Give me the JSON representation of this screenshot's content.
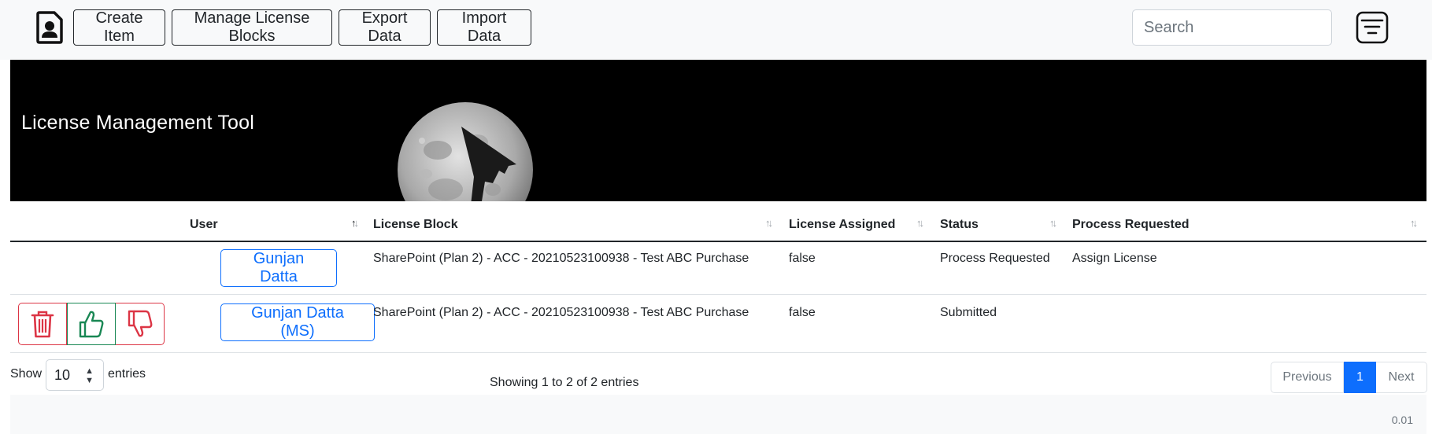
{
  "nav": {
    "logo_icon": "user-document-icon",
    "buttons": [
      "Create Item",
      "Manage License Blocks",
      "Export Data",
      "Import Data"
    ],
    "search_placeholder": "Search",
    "filter_icon": "filter-lines-icon"
  },
  "banner": {
    "title": "License Management Tool",
    "image": "moon-with-stealth-bomber"
  },
  "table": {
    "columns": [
      "User",
      "License Block",
      "License Assigned",
      "Status",
      "Process Requested"
    ],
    "sort": {
      "column": "User",
      "direction": "ascending"
    },
    "rows": [
      {
        "user": "Gunjan Datta",
        "license_block": "SharePoint (Plan 2) - ACC - 20210523100938 - Test ABC Purchase",
        "license_assigned": "false",
        "status": "Process Requested",
        "process_requested": "Assign License",
        "actions": []
      },
      {
        "user": "Gunjan Datta (MS)",
        "license_block": "SharePoint (Plan 2) - ACC - 20210523100938 - Test ABC Purchase",
        "license_assigned": "false",
        "status": "Submitted",
        "process_requested": "",
        "actions": [
          "trash-icon",
          "thumbs-up-icon",
          "thumbs-down-icon"
        ]
      }
    ]
  },
  "footer_controls": {
    "show_label": "Show",
    "entries_label": "entries",
    "page_length": "10",
    "info": "Showing 1 to 2 of 2 entries",
    "previous": "Previous",
    "current_page": "1",
    "next": "Next"
  },
  "colors": {
    "primary": "#0d6efd",
    "danger": "#dc3545",
    "success": "#198754",
    "banner_bg": "#000000",
    "nav_bg": "#f8f9fa"
  },
  "version": "0.01"
}
